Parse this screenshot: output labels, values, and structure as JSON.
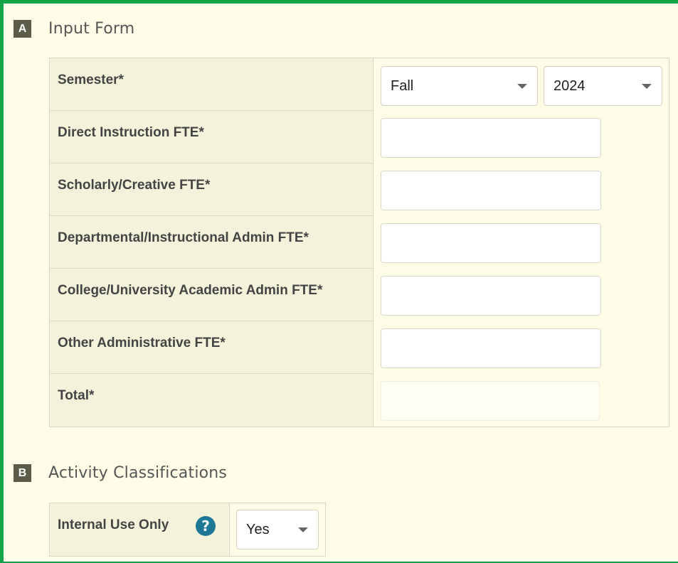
{
  "section_a": {
    "letter": "A",
    "title": "Input Form",
    "semester": {
      "label": "Semester*",
      "term_value": "Fall",
      "year_value": "2024"
    },
    "fields": [
      {
        "label": "Direct Instruction FTE*",
        "value": ""
      },
      {
        "label": "Scholarly/Creative FTE*",
        "value": ""
      },
      {
        "label": "Departmental/Instructional Admin FTE*",
        "value": ""
      },
      {
        "label": "College/University Academic Admin FTE*",
        "value": ""
      },
      {
        "label": "Other Administrative FTE*",
        "value": ""
      }
    ],
    "total": {
      "label": "Total*",
      "value": ""
    }
  },
  "section_b": {
    "letter": "B",
    "title": "Activity Classifications",
    "internal_use": {
      "label": "Internal Use Only",
      "help_glyph": "?",
      "value": "Yes"
    }
  },
  "colors": {
    "accent_border": "#14a54a",
    "background": "#fefee8",
    "label_bg": "#f3f3dc",
    "help_icon": "#1f7796",
    "section_badge": "#5c5c4a"
  }
}
